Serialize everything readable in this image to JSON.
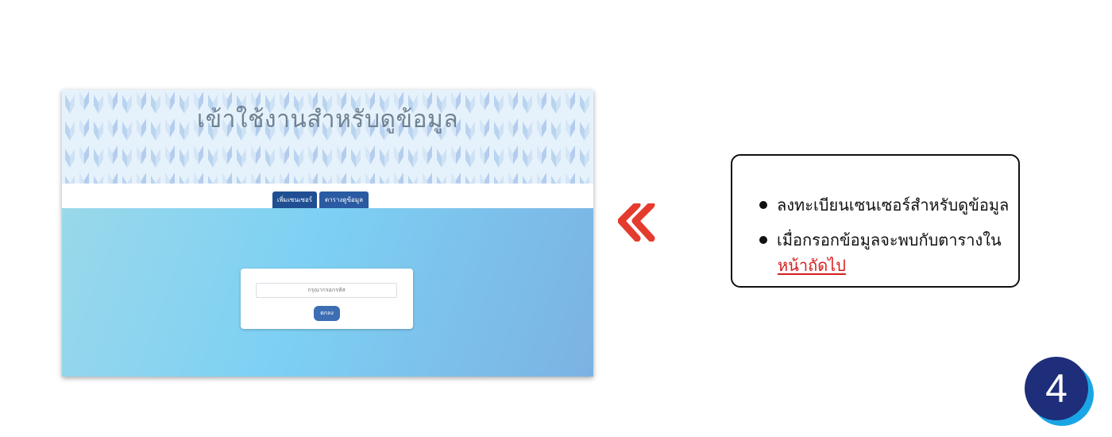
{
  "screenshot": {
    "banner_title": "เข้าใช้งานสำหรับดูข้อมูล",
    "tabs": [
      {
        "label": "เพิ่มเซนเซอร์"
      },
      {
        "label": "ตารางดูข้อมูล"
      }
    ],
    "code_input": {
      "placeholder": "กรุณากรอกรหัส"
    },
    "submit_label": "ตกลง"
  },
  "arrow_icon": "double-chevron-left-icon",
  "instructions": {
    "items": [
      "ลงทะเบียนเซนเซอร์สำหรับดูข้อมูล",
      "เมื่อกรอกข้อมูลจะพบกับตารางใน"
    ],
    "link_text": "หน้าถัดไป"
  },
  "step_number": "4",
  "colors": {
    "accent_red": "#e53b2e",
    "tab_blue": "#2a5aa2",
    "badge_navy": "#1e2e7a",
    "badge_cyan": "#1aa6e6"
  }
}
